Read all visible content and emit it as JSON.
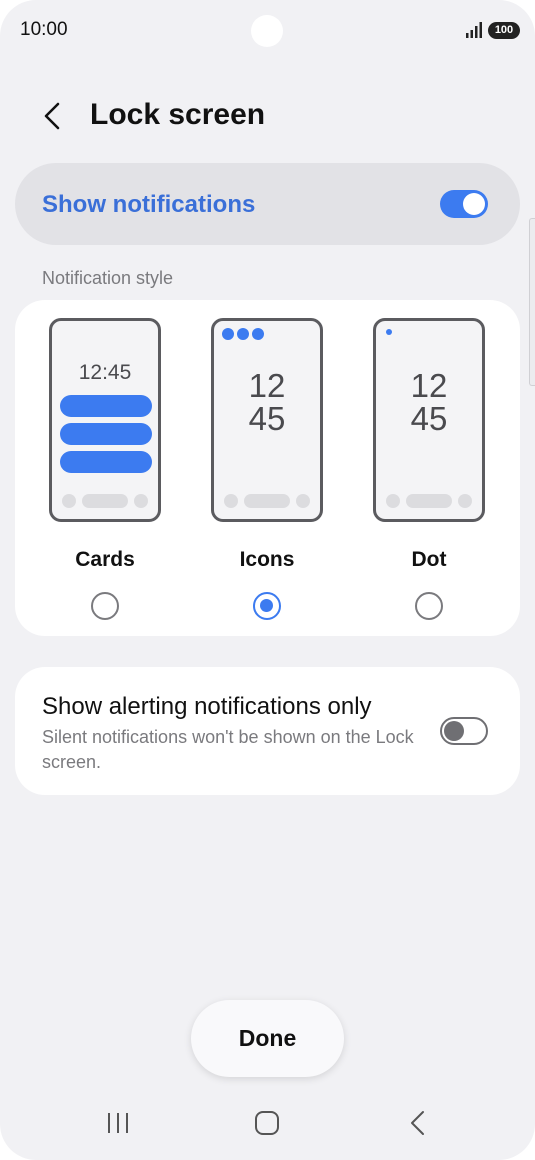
{
  "status_bar": {
    "time": "10:00",
    "battery": "100",
    "icons": [
      "camera-cutout",
      "signal-icon",
      "battery-icon"
    ]
  },
  "header": {
    "title": "Lock screen",
    "back_icon": "chevron-left-icon"
  },
  "show_notifications": {
    "label": "Show notifications",
    "enabled": true
  },
  "notification_style": {
    "section_title": "Notification style",
    "options": [
      {
        "label": "Cards",
        "preview_time": "12:45",
        "selected": false
      },
      {
        "label": "Icons",
        "preview_hour": "12",
        "preview_minute": "45",
        "selected": true
      },
      {
        "label": "Dot",
        "preview_hour": "12",
        "preview_minute": "45",
        "selected": false
      }
    ]
  },
  "alerting_only": {
    "title": "Show alerting notifications only",
    "subtitle": "Silent notifications won't be shown on the Lock screen.",
    "enabled": false
  },
  "done_button": {
    "label": "Done"
  },
  "nav_bar": {
    "icons": [
      "recent-apps-icon",
      "home-icon",
      "back-icon"
    ]
  },
  "colors": {
    "accent": "#3c7bf0",
    "accent_text": "#3a6fd8",
    "background": "#f1f1f4",
    "card": "#ffffff"
  }
}
